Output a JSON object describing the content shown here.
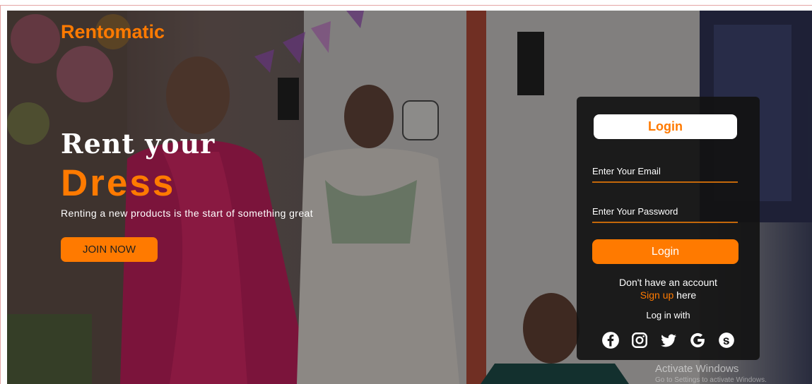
{
  "brand": {
    "name": "Rentomatic",
    "accent_color": "#ff7a00"
  },
  "hero": {
    "headline": "Rent your",
    "headline_accent": "Dress",
    "tagline": "Renting a new products is the start of something great",
    "join_button": "JOIN NOW"
  },
  "login_panel": {
    "title": "Login",
    "email_placeholder": "Enter Your Email",
    "password_placeholder": "Enter Your Password",
    "login_button": "Login",
    "no_account_text": "Don't have an account",
    "signup_link": "Sign up",
    "signup_suffix": "here",
    "login_with_text": "Log in with",
    "social_icons": [
      "facebook-icon",
      "instagram-icon",
      "twitter-icon",
      "google-icon",
      "skype-icon"
    ]
  },
  "watermark": {
    "title": "Activate Windows",
    "subtitle": "Go to Settings to activate Windows."
  }
}
